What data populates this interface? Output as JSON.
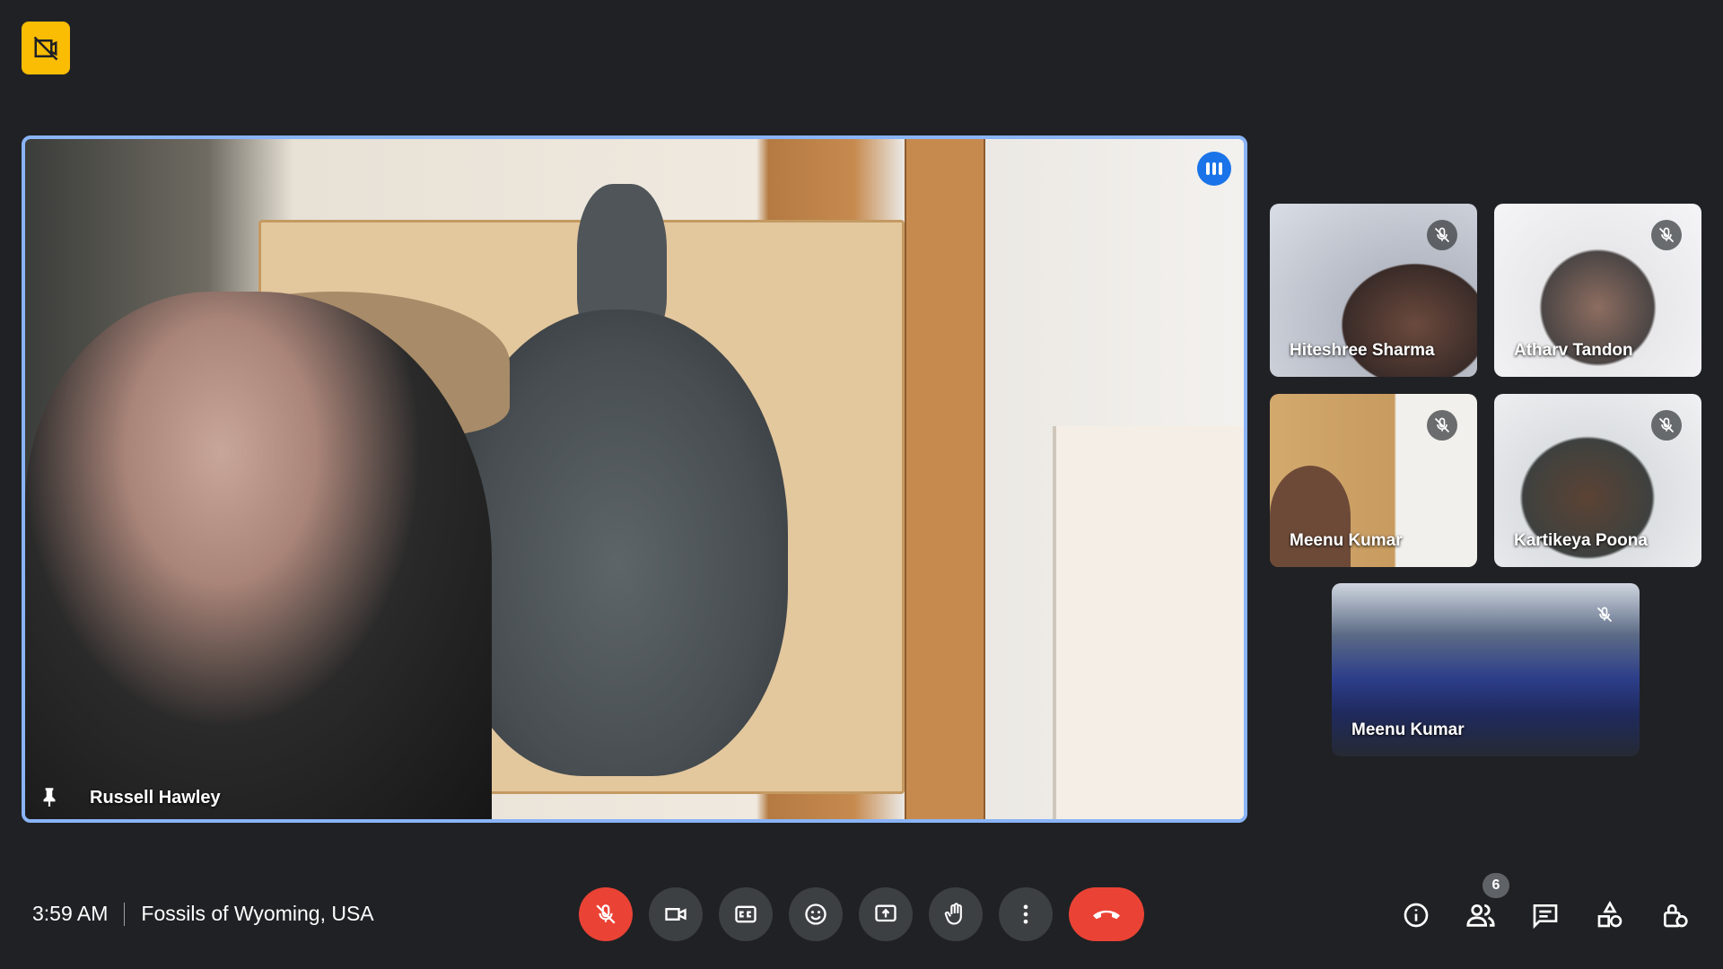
{
  "main_speaker": {
    "name": "Russell Hawley"
  },
  "tiles": [
    {
      "name": "Hiteshree Sharma"
    },
    {
      "name": "Atharv Tandon"
    },
    {
      "name": "Meenu Kumar"
    },
    {
      "name": "Kartikeya Poona"
    },
    {
      "name": "Meenu Kumar"
    }
  ],
  "bottom_bar": {
    "time": "3:59 AM",
    "meeting_title": "Fossils of Wyoming, USA",
    "participant_count": "6"
  },
  "colors": {
    "accent": "#8ab4f8",
    "danger": "#ea4335",
    "badge": "#fbbc04",
    "background": "#202124"
  },
  "icons": [
    "no-camera-badge-icon",
    "speaking-icon",
    "pin-icon",
    "mic-off-icon",
    "camera-icon",
    "captions-icon",
    "emoji-icon",
    "present-icon",
    "raise-hand-icon",
    "more-options-icon",
    "hang-up-icon",
    "info-icon",
    "people-icon",
    "chat-icon",
    "activities-icon",
    "host-controls-icon"
  ]
}
